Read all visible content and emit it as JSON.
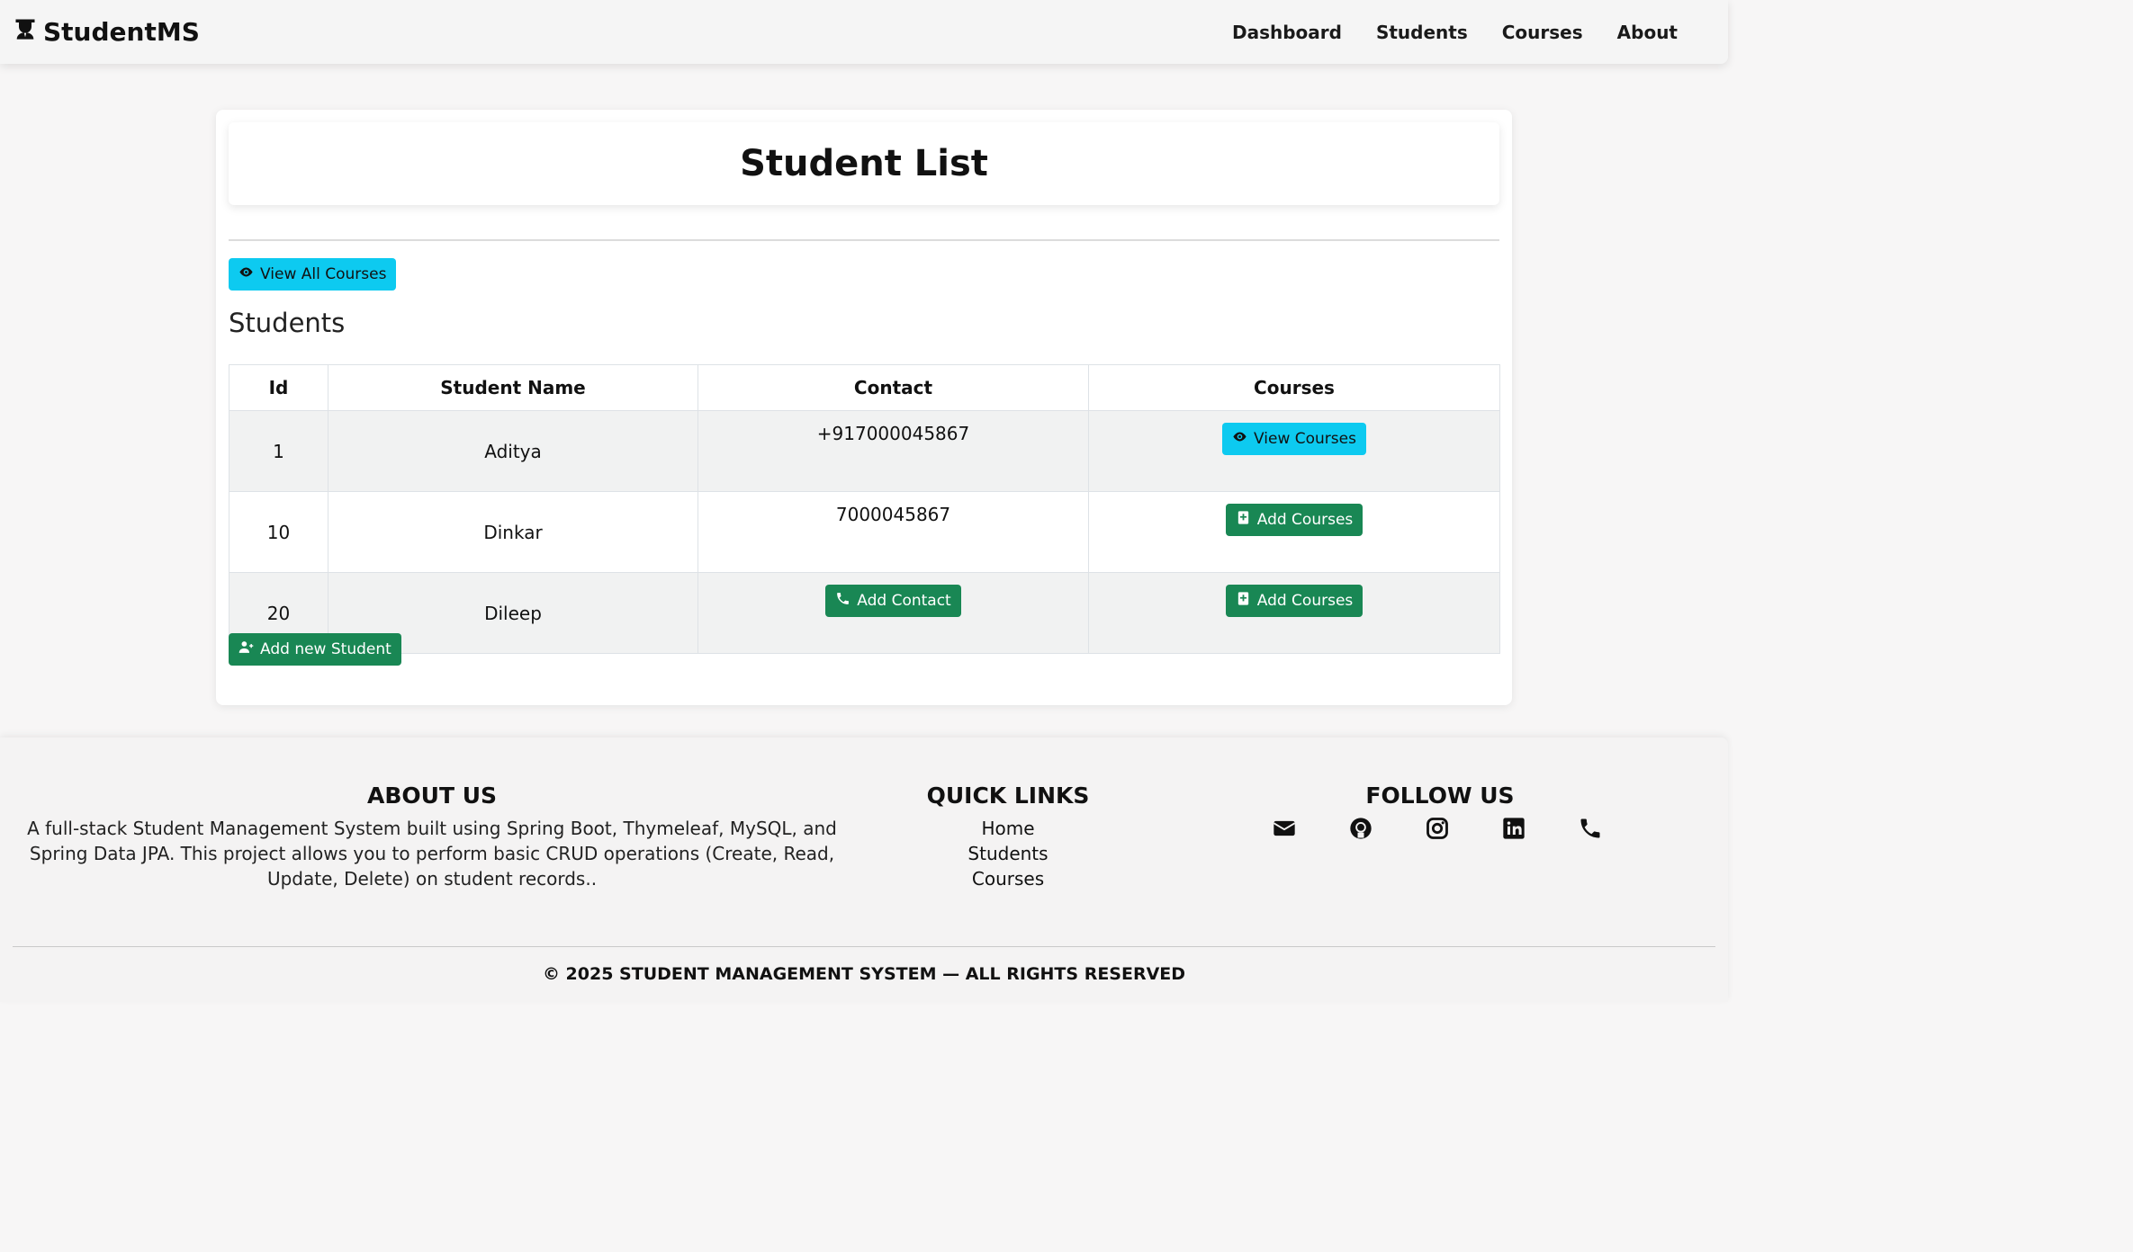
{
  "navbar": {
    "brand": "StudentMS",
    "links": [
      "Dashboard",
      "Students",
      "Courses",
      "About"
    ]
  },
  "page": {
    "title": "Student List",
    "view_all_courses": "View All Courses",
    "section_title": "Students",
    "add_new_student": "Add new Student"
  },
  "table": {
    "headers": [
      "Id",
      "Student Name",
      "Contact",
      "Courses"
    ],
    "rows": [
      {
        "id": "1",
        "name": "Aditya",
        "contact": "+917000045867",
        "courses_button": "View Courses"
      },
      {
        "id": "10",
        "name": "Dinkar",
        "contact": "7000045867",
        "courses_button": "Add Courses"
      },
      {
        "id": "20",
        "name": "Dileep",
        "contact_button": "Add Contact",
        "courses_button": "Add Courses"
      }
    ]
  },
  "footer": {
    "about_title": "ABOUT US",
    "about_text": "A full-stack Student Management System built using Spring Boot, Thymeleaf, MySQL, and Spring Data JPA. This project allows you to perform basic CRUD operations (Create, Read, Update, Delete) on student records..",
    "links_title": "QUICK LINKS",
    "links": [
      "Home",
      "Students",
      "Courses"
    ],
    "follow_title": "FOLLOW US",
    "social_icons": [
      "envelope-icon",
      "github-icon",
      "instagram-icon",
      "linkedin-icon",
      "phone-icon"
    ],
    "copyright": "© 2025 STUDENT MANAGEMENT SYSTEM — ALL RIGHTS RESERVED"
  },
  "colors": {
    "info": "#0dcaf0",
    "success": "#198754",
    "background": "#f7f6f6"
  }
}
